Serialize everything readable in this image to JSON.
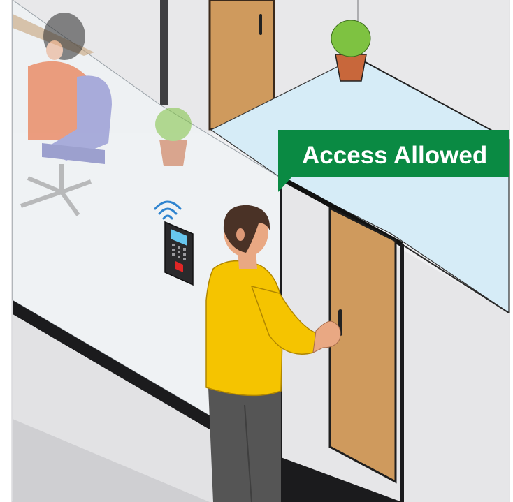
{
  "illustration": {
    "status_badge": {
      "label": "Access Allowed",
      "color": "#0a8a43"
    },
    "colors": {
      "wall": "#e6e6e8",
      "glass": "#d8ecf7",
      "door": "#cf9a5d",
      "shirt": "#f5c400",
      "trousers": "#555555",
      "hair": "#4a3226",
      "skin": "#e9a883",
      "chair": "#6f73c6",
      "plant_leaves": "#7ec241",
      "plant_pot": "#c8673b"
    },
    "icons": [
      "wifi-icon",
      "keypad-icon",
      "fingerprint-sensor-icon"
    ]
  }
}
